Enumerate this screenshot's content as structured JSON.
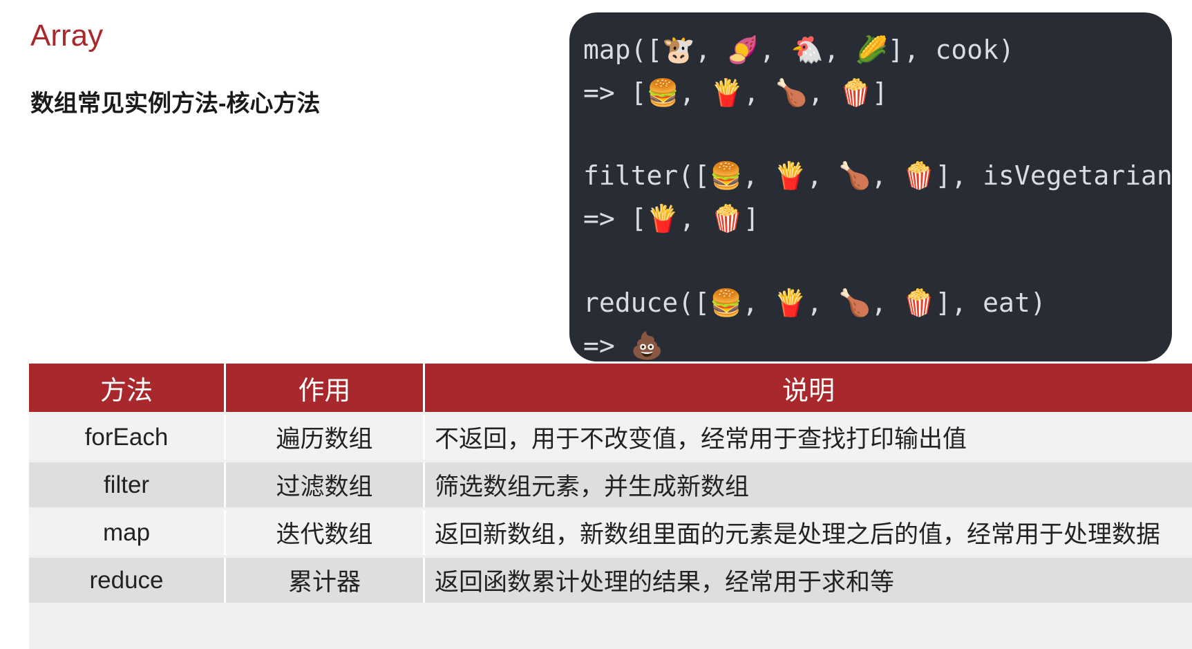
{
  "title": "Array",
  "subtitle": "数组常见实例方法-核心方法",
  "code_lines": [
    "map([🐮, 🍠, 🐔, 🌽], cook)",
    "=> [🍔, 🍟, 🍗, 🍿]",
    "filter([🍔, 🍟, 🍗, 🍿], isVegetarian)",
    "=> [🍟, 🍿]",
    "reduce([🍔, 🍟, 🍗, 🍿], eat)",
    "=> 💩"
  ],
  "table": {
    "headers": [
      "方法",
      "作用",
      "说明"
    ],
    "rows": [
      [
        "forEach",
        "遍历数组",
        "不返回，用于不改变值，经常用于查找打印输出值"
      ],
      [
        "filter",
        "过滤数组",
        "筛选数组元素，并生成新数组"
      ],
      [
        "map",
        "迭代数组",
        "返回新数组，新数组里面的元素是处理之后的值，经常用于处理数据"
      ],
      [
        "reduce",
        "累计器",
        "返回函数累计处理的结果，经常用于求和等"
      ]
    ]
  },
  "colors": {
    "accent": "#a8282b",
    "code_background": "#282c34",
    "row_light": "#f2f2f2",
    "row_dark": "#dedede"
  }
}
